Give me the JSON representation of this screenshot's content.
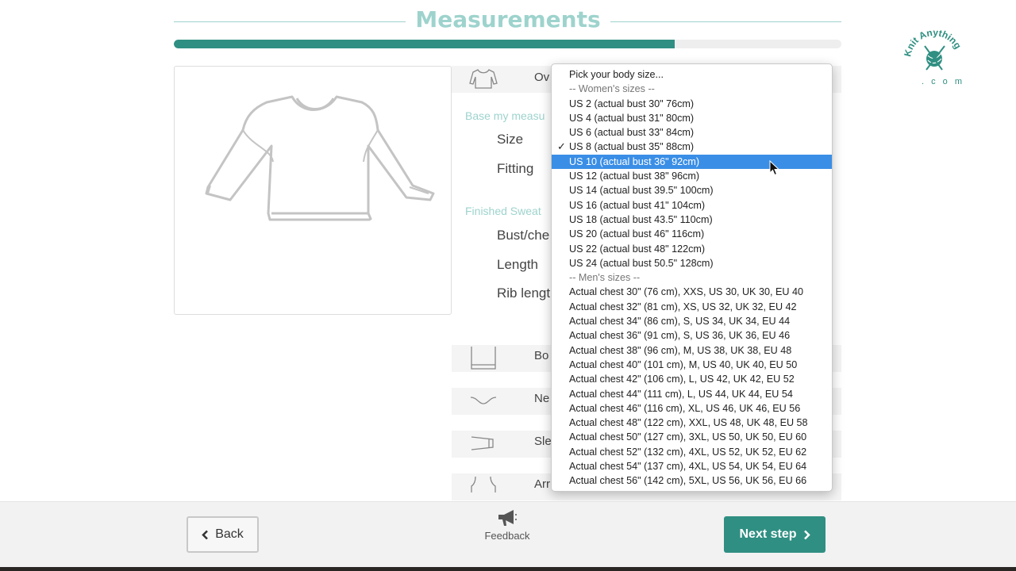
{
  "page": {
    "title": "Measurements",
    "progress_fraction": 0.75,
    "logo_text": "Knit Anything . com"
  },
  "rows": {
    "overview_label": "Ov",
    "body_label": "Bo",
    "neck_label": "Ne",
    "sleeve_label": "Sle",
    "arm_label": "Arr"
  },
  "form": {
    "base_heading": "Base my measu",
    "size_label": "Size",
    "fitting_label": "Fitting",
    "finished_heading": "Finished  Sweat",
    "bust_label": "Bust/che",
    "length_label": "Length",
    "rib_label": "Rib lengt"
  },
  "dropdown": {
    "options": [
      {
        "label": "Pick your body size...",
        "kind": "option"
      },
      {
        "label": "-- Women's sizes --",
        "kind": "group"
      },
      {
        "label": "US 2 (actual bust 30\" 76cm)",
        "kind": "option"
      },
      {
        "label": "US 4 (actual bust 31\" 80cm)",
        "kind": "option"
      },
      {
        "label": "US 6 (actual bust 33\" 84cm)",
        "kind": "option"
      },
      {
        "label": "US 8 (actual bust 35\" 88cm)",
        "kind": "option",
        "checked": true
      },
      {
        "label": "US 10 (actual bust 36\" 92cm)",
        "kind": "option",
        "highlighted": true
      },
      {
        "label": "US 12 (actual bust 38\" 96cm)",
        "kind": "option"
      },
      {
        "label": "US 14 (actual bust 39.5\" 100cm)",
        "kind": "option"
      },
      {
        "label": "US 16 (actual bust 41\" 104cm)",
        "kind": "option"
      },
      {
        "label": "US 18 (actual bust 43.5\" 110cm)",
        "kind": "option"
      },
      {
        "label": "US 20 (actual bust 46\" 116cm)",
        "kind": "option"
      },
      {
        "label": "US 22 (actual bust 48\" 122cm)",
        "kind": "option"
      },
      {
        "label": "US 24 (actual bust 50.5\" 128cm)",
        "kind": "option"
      },
      {
        "label": "-- Men's sizes --",
        "kind": "group"
      },
      {
        "label": "Actual chest 30\" (76 cm), XXS, US 30, UK 30, EU 40",
        "kind": "option"
      },
      {
        "label": "Actual chest 32\" (81 cm), XS, US 32, UK 32, EU 42",
        "kind": "option"
      },
      {
        "label": "Actual chest 34\" (86 cm), S, US 34, UK 34, EU 44",
        "kind": "option"
      },
      {
        "label": "Actual chest 36\" (91 cm), S, US 36, UK 36, EU 46",
        "kind": "option"
      },
      {
        "label": "Actual chest 38\" (96 cm), M, US 38, UK 38, EU 48",
        "kind": "option"
      },
      {
        "label": "Actual chest 40\" (101 cm), M, US 40, UK 40, EU 50",
        "kind": "option"
      },
      {
        "label": "Actual chest 42\" (106 cm), L, US 42, UK 42, EU 52",
        "kind": "option"
      },
      {
        "label": "Actual chest 44\" (111 cm), L, US 44, UK 44, EU 54",
        "kind": "option"
      },
      {
        "label": "Actual chest 46\" (116 cm), XL, US 46, UK 46, EU 56",
        "kind": "option"
      },
      {
        "label": "Actual chest 48\" (122 cm), XXL, US 48, UK 48, EU 58",
        "kind": "option"
      },
      {
        "label": "Actual chest 50\" (127 cm), 3XL, US 50, UK 50, EU 60",
        "kind": "option"
      },
      {
        "label": "Actual chest 52\" (132 cm), 4XL, US 52, UK 52, EU 62",
        "kind": "option"
      },
      {
        "label": "Actual chest 54\" (137 cm), 4XL, US 54, UK 54, EU 64",
        "kind": "option"
      },
      {
        "label": "Actual chest 56\" (142 cm), 5XL, US 56, UK 56, EU 66",
        "kind": "option"
      }
    ],
    "check_glyph": "✓"
  },
  "footer": {
    "back_label": "Back",
    "feedback_label": "Feedback",
    "next_label": "Next step"
  },
  "icons": {
    "back": "chevron-left-icon",
    "next": "chevron-right-icon",
    "feedback": "megaphone-icon"
  },
  "colors": {
    "accent": "#2f8f82",
    "accent_light": "#9ed3cd",
    "highlight": "#3a8ee6"
  }
}
